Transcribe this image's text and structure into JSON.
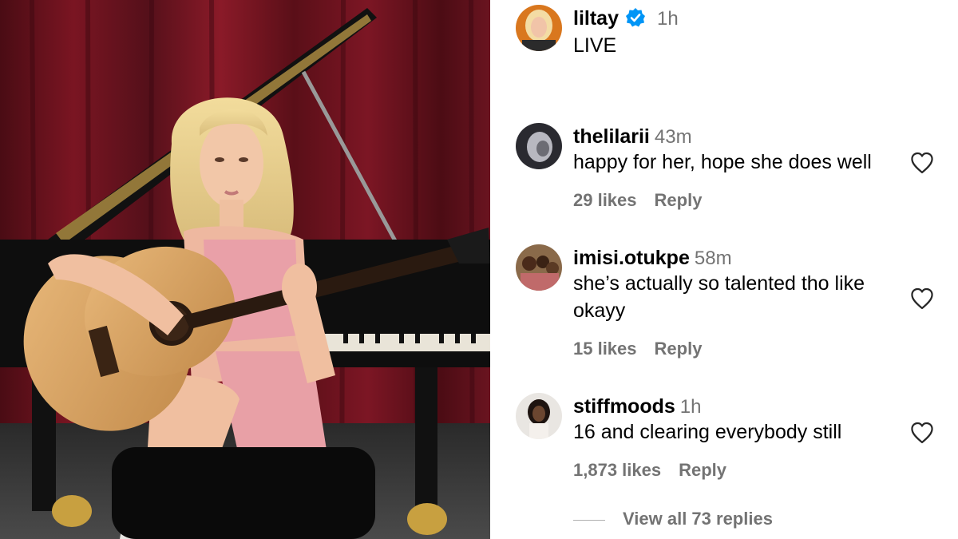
{
  "post": {
    "author": "liltay",
    "verified": true,
    "time": "1h",
    "caption": "LIVE"
  },
  "comments": [
    {
      "username": "thelilarii",
      "time": "43m",
      "text_lines": [
        "happy for her, hope she does well"
      ],
      "likes": "29 likes",
      "reply": "Reply"
    },
    {
      "username": "imisi.otukpe",
      "time": "58m",
      "text_lines": [
        "she’s actually so talented tho like",
        "okayy"
      ],
      "likes": "15 likes",
      "reply": "Reply"
    },
    {
      "username": "stiffmoods",
      "time": "1h",
      "text_lines": [
        "16 and clearing everybody still"
      ],
      "likes": "1,873 likes",
      "reply": "Reply"
    }
  ],
  "view_replies": "View all 73 replies",
  "icons": {
    "verified": "verified-badge-icon",
    "like": "heart-outline-icon"
  },
  "colors": {
    "verified": "#0095F6",
    "secondary_text": "#737373"
  }
}
